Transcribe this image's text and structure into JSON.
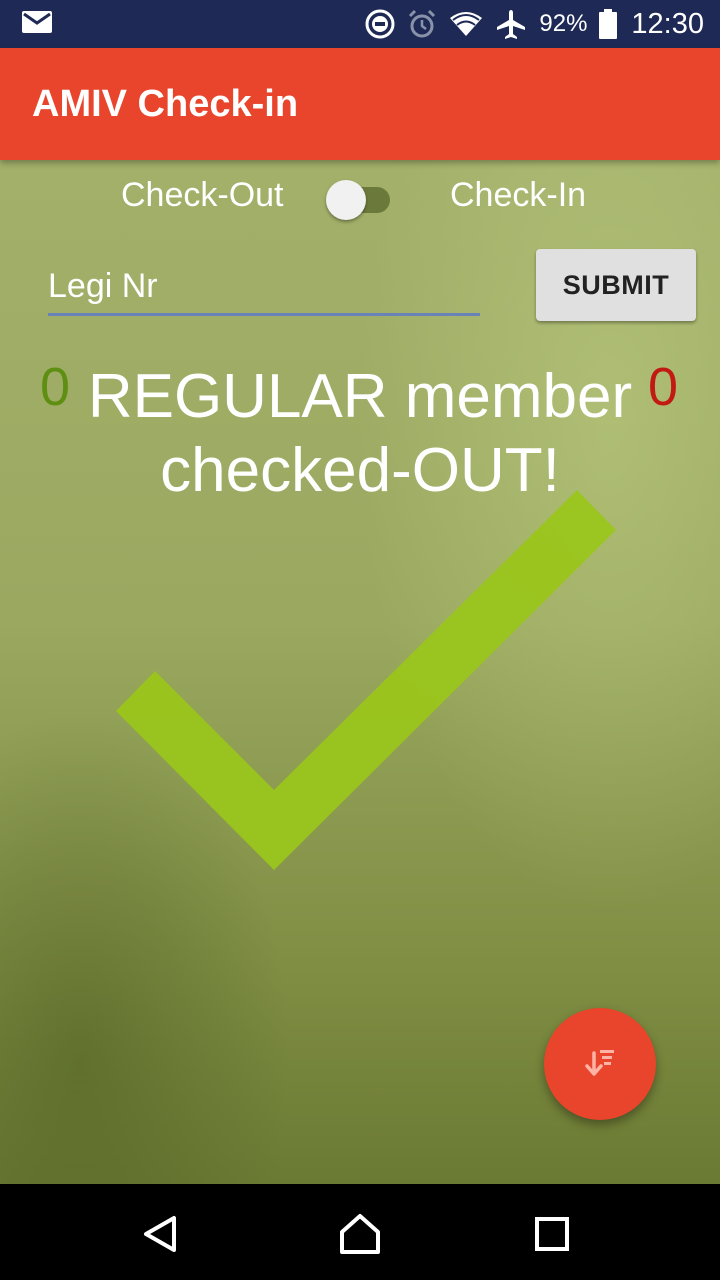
{
  "status_bar": {
    "battery_percent": "92%",
    "time": "12:30",
    "icons": [
      "mail-icon",
      "do-not-disturb-icon",
      "alarm-icon",
      "wifi-icon",
      "airplane-icon",
      "battery-icon"
    ]
  },
  "app_bar": {
    "title": "AMIV Check-in",
    "color": "#e8452c"
  },
  "toggle": {
    "left_label": "Check-Out",
    "right_label": "Check-In",
    "state": "off"
  },
  "legi_input": {
    "placeholder": "Legi Nr",
    "value": ""
  },
  "submit_button": {
    "label": "SUBMIT"
  },
  "counters": {
    "left": "0",
    "left_color": "#5e8f12",
    "right": "0",
    "right_color": "#c21a12"
  },
  "message": {
    "line1": "REGULAR member",
    "line2": "checked-OUT!"
  },
  "result_icon": {
    "name": "checkmark-icon",
    "color": "#9ac51b"
  },
  "fab": {
    "icon": "sort-descending-icon"
  },
  "nav_bar": {
    "icons": [
      "back-icon",
      "home-icon",
      "recents-icon"
    ]
  }
}
